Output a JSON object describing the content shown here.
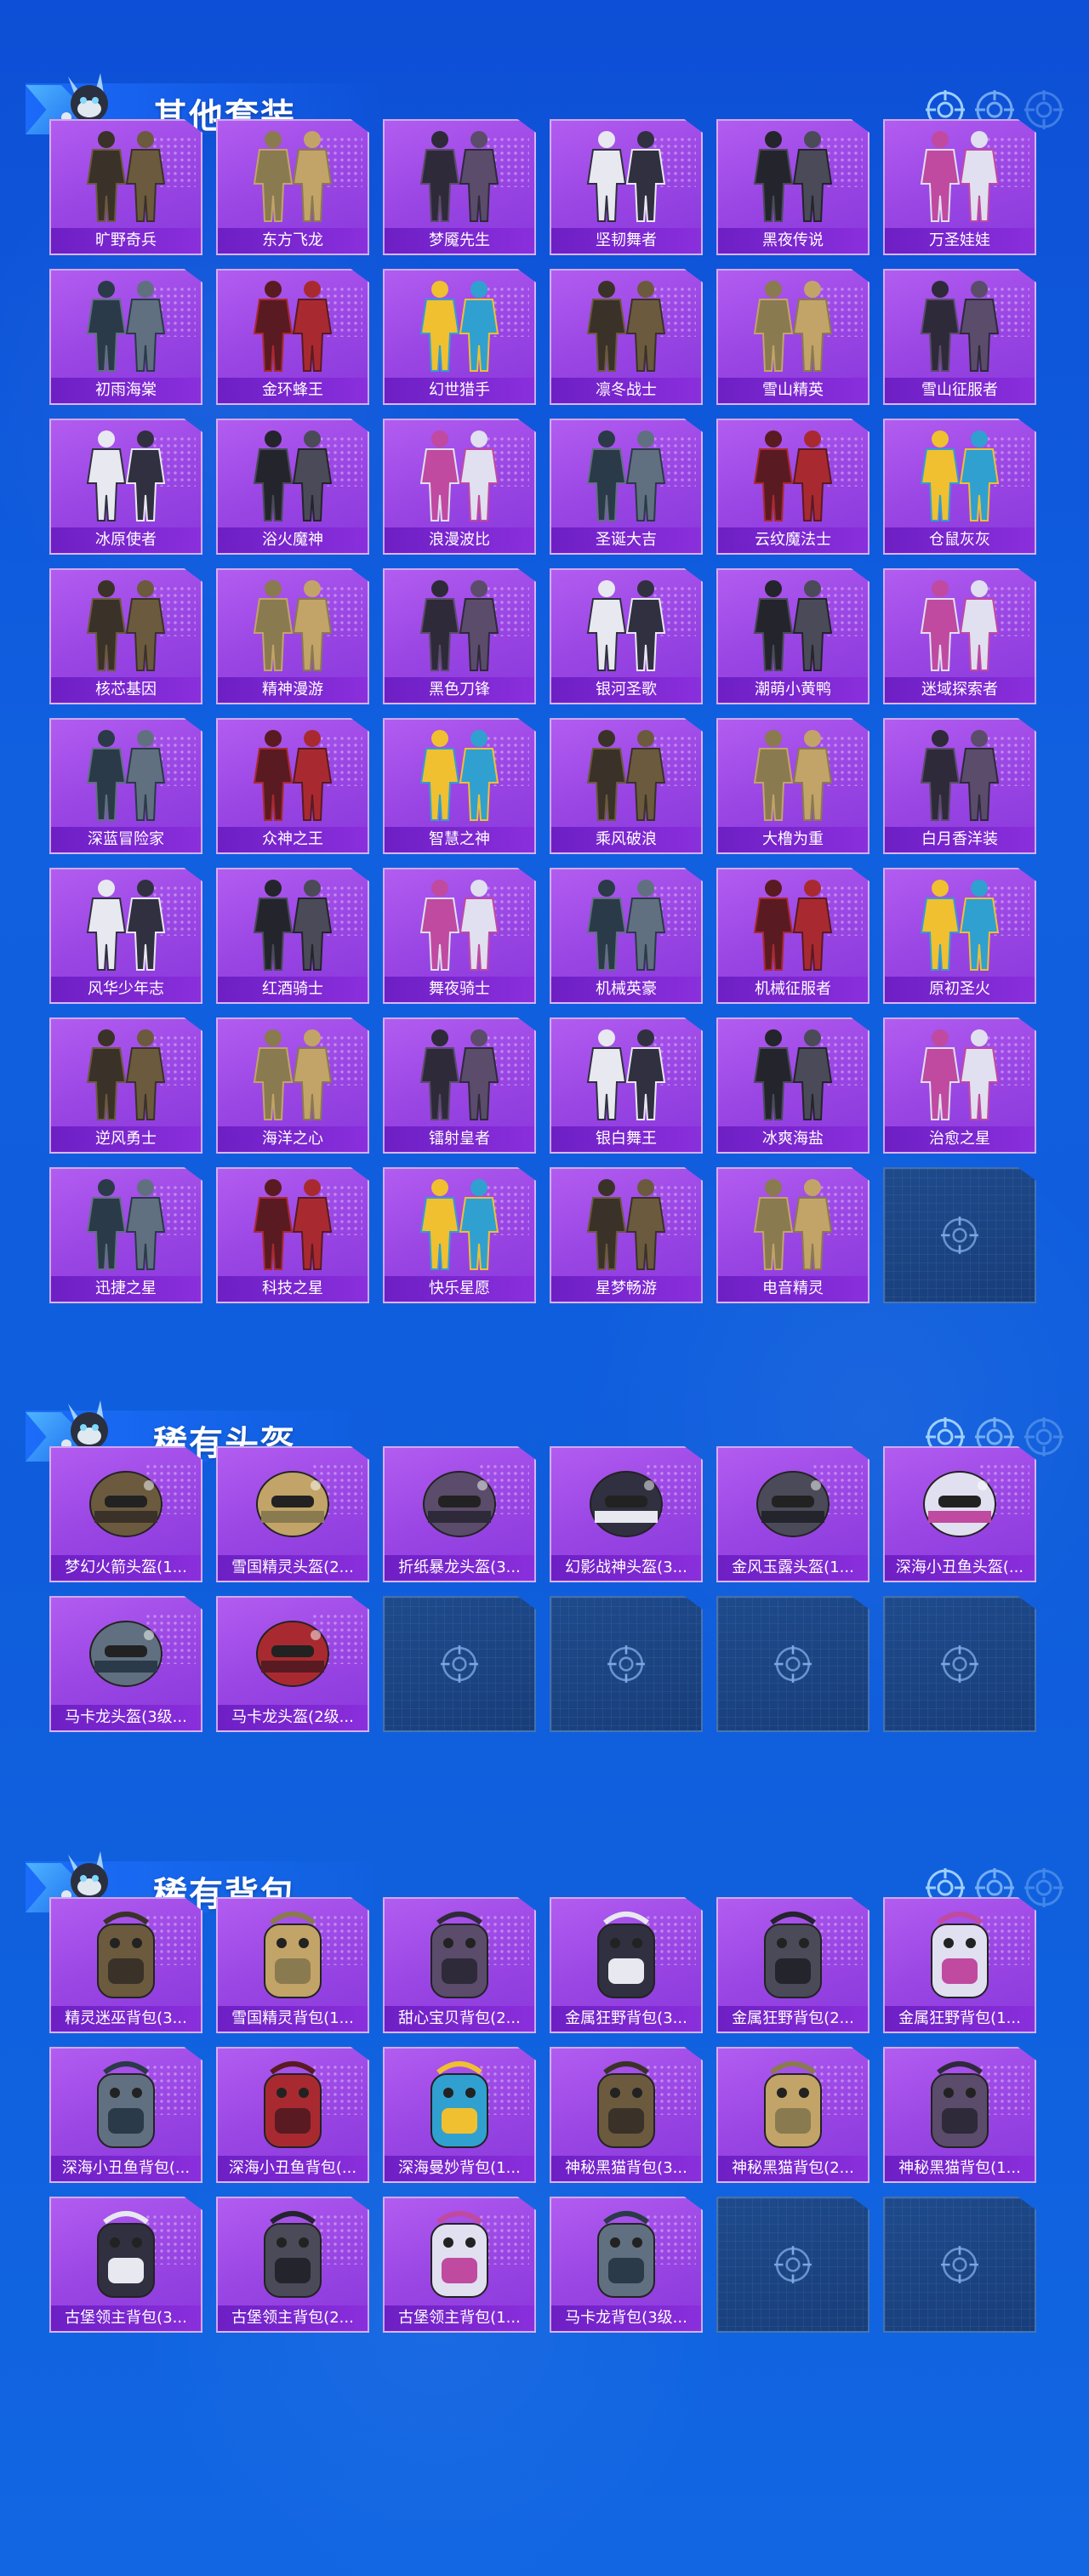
{
  "colors": {
    "background": "#0f5ddc",
    "card_purple": "#9a46e4",
    "card_label": "#6d1fc4",
    "empty_card": "#1e4a8c"
  },
  "sections": [
    {
      "title": "其他套装",
      "items": [
        "旷野奇兵",
        "东方飞龙",
        "梦魇先生",
        "坚韧舞者",
        "黑夜传说",
        "万圣娃娃",
        "初雨海棠",
        "金环蜂王",
        "幻世猎手",
        "凛冬战士",
        "雪山精英",
        "雪山征服者",
        "冰原使者",
        "浴火魔神",
        "浪漫波比",
        "圣诞大吉",
        "云纹魔法士",
        "仓鼠灰灰",
        "核芯基因",
        "精神漫游",
        "黑色刀锋",
        "银河圣歌",
        "潮萌小黄鸭",
        "迷域探索者",
        "深蓝冒险家",
        "众神之王",
        "智慧之神",
        "乘风破浪",
        "大橹为重",
        "白月香洋装",
        "风华少年志",
        "红酒骑士",
        "舞夜骑士",
        "机械英豪",
        "机械征服者",
        "原初圣火",
        "逆风勇士",
        "海洋之心",
        "镭射皇者",
        "银白舞王",
        "冰爽海盐",
        "治愈之星",
        "迅捷之星",
        "科技之星",
        "快乐星愿",
        "星梦畅游",
        "电音精灵"
      ],
      "empty_slots": 1
    },
    {
      "title": "稀有头盔",
      "items": [
        "梦幻火箭头盔(1...",
        "雪国精灵头盔(2...",
        "折纸暴龙头盔(3...",
        "幻影战神头盔(3...",
        "金风玉露头盔(1...",
        "深海小丑鱼头盔(...",
        "马卡龙头盔(3级...",
        "马卡龙头盔(2级..."
      ],
      "empty_slots": 4
    },
    {
      "title": "稀有背包",
      "items": [
        "精灵迷巫背包(3...",
        "雪国精灵背包(1...",
        "甜心宝贝背包(2...",
        "金属狂野背包(3...",
        "金属狂野背包(2...",
        "金属狂野背包(1...",
        "深海小丑鱼背包(...",
        "深海小丑鱼背包(...",
        "深海曼妙背包(1...",
        "神秘黑猫背包(3...",
        "神秘黑猫背包(2...",
        "神秘黑猫背包(1...",
        "古堡领主背包(3...",
        "古堡领主背包(2...",
        "古堡领主背包(1...",
        "马卡龙背包(3级..."
      ],
      "empty_slots": 2
    }
  ]
}
